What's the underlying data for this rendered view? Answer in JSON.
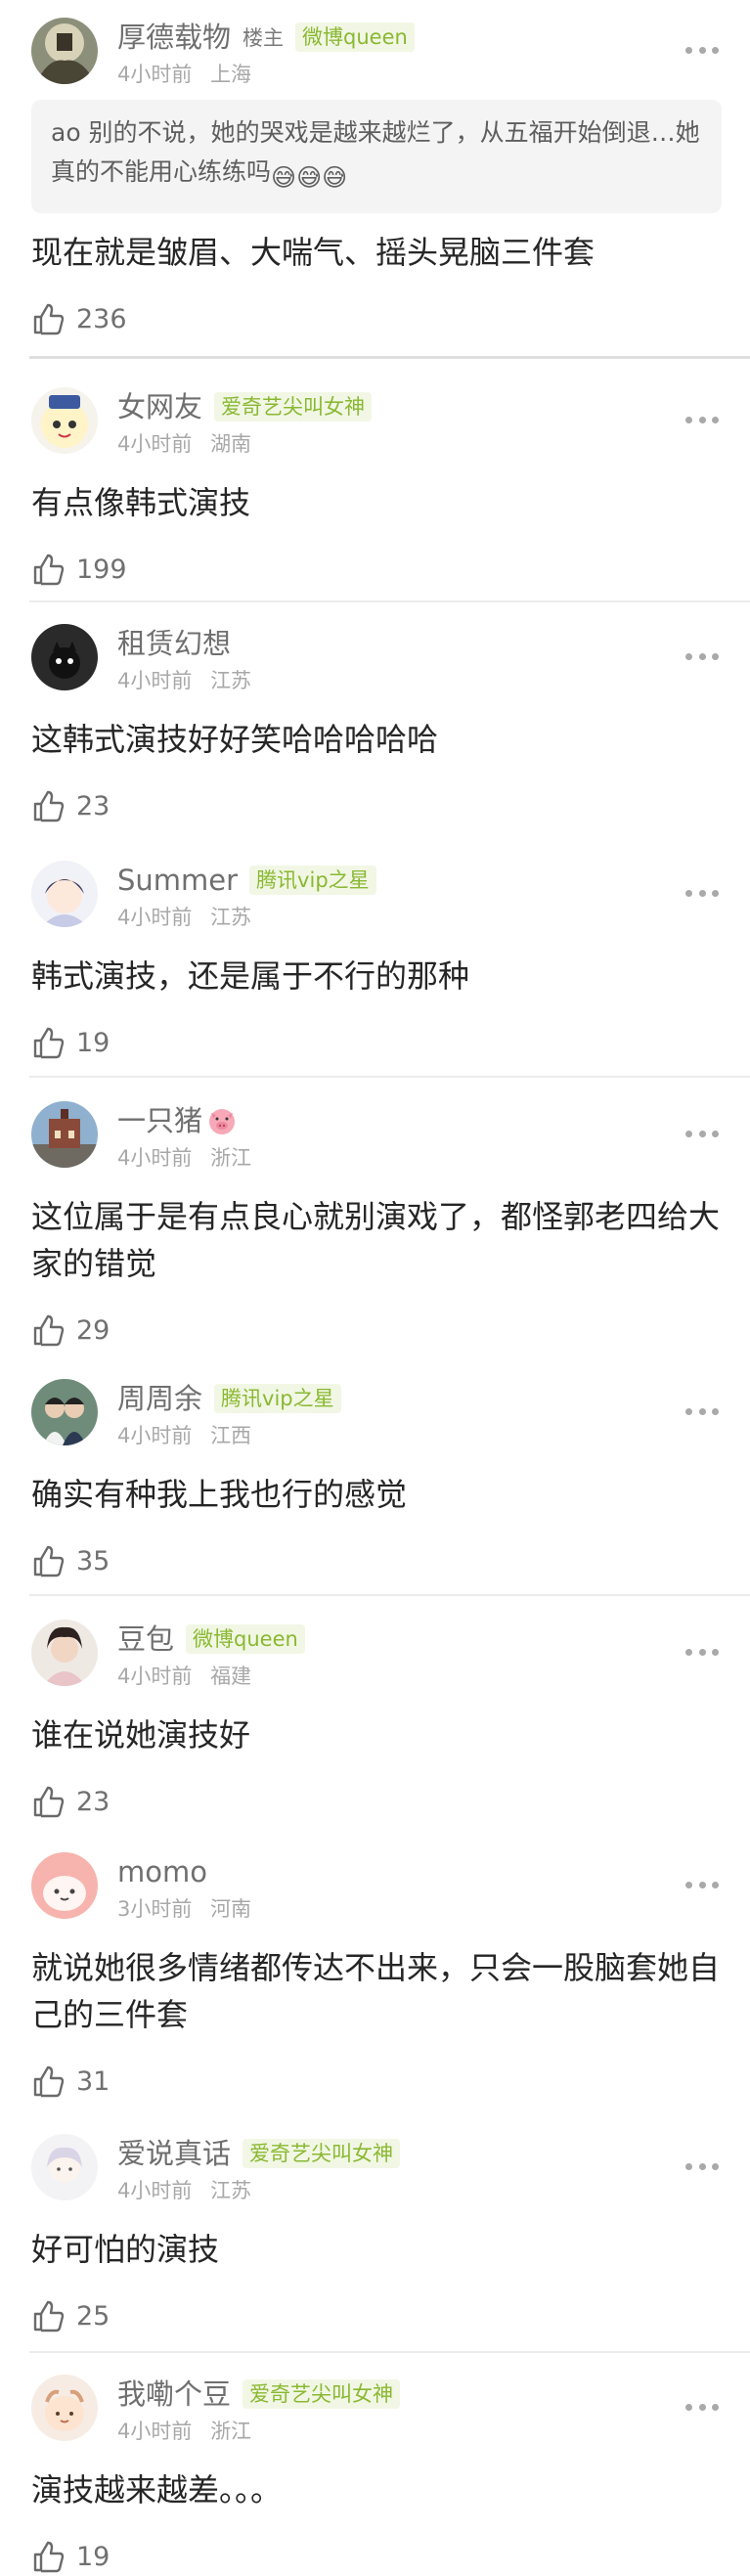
{
  "pinned": {
    "username": "厚德载物",
    "op_tag": "楼主",
    "badge": "微博queen",
    "time": "4小时前",
    "location": "上海",
    "quote": "ao 别的不说，她的哭戏是越来越烂了，从五福开始倒退…她真的不能用心练练吗",
    "quote_emojis": "😅😅😅",
    "text": "现在就是皱眉、大喘气、摇头晃脑三件套",
    "likes": "236"
  },
  "comments": [
    {
      "username": "女网友",
      "badge": "爱奇艺尖叫女神",
      "time": "4小时前",
      "location": "湖南",
      "text": "有点像韩式演技",
      "likes": "199"
    },
    {
      "username": "租赁幻想",
      "badge": "",
      "time": "4小时前",
      "location": "江苏",
      "text": "这韩式演技好好笑哈哈哈哈哈",
      "likes": "23"
    },
    {
      "username": "Summer",
      "badge": "腾讯vip之星",
      "time": "4小时前",
      "location": "江苏",
      "text": "韩式演技，还是属于不行的那种",
      "likes": "19"
    },
    {
      "username": "一只猪",
      "badge": "",
      "time": "4小时前",
      "location": "浙江",
      "text": "这位属于是有点良心就别演戏了，都怪郭老四给大家的错觉",
      "likes": "29"
    },
    {
      "username": "周周余",
      "badge": "腾讯vip之星",
      "time": "4小时前",
      "location": "江西",
      "text": "确实有种我上我也行的感觉",
      "likes": "35"
    },
    {
      "username": "豆包",
      "badge": "微博queen",
      "time": "4小时前",
      "location": "福建",
      "text": "谁在说她演技好",
      "likes": "23"
    },
    {
      "username": "momo",
      "badge": "",
      "time": "3小时前",
      "location": "河南",
      "text": "就说她很多情绪都传达不出来，只会一股脑套她自己的三件套",
      "likes": "31"
    },
    {
      "username": "爱说真话",
      "badge": "爱奇艺尖叫女神",
      "time": "4小时前",
      "location": "江苏",
      "text": "好可怕的演技",
      "likes": "25"
    },
    {
      "username": "我嘞个豆",
      "badge": "爱奇艺尖叫女神",
      "time": "4小时前",
      "location": "浙江",
      "text": "演技越来越差。。。",
      "likes": "19"
    }
  ],
  "colors": {
    "badge_text": "#8ab832",
    "badge_bg": "#f1f7e4",
    "meta_text": "#a8a8a8",
    "username": "#6f6f6f"
  },
  "icons": {
    "like": "thumbs-up-outline-icon",
    "more": "more-dots-icon",
    "pig": "pig-face-emoji"
  }
}
